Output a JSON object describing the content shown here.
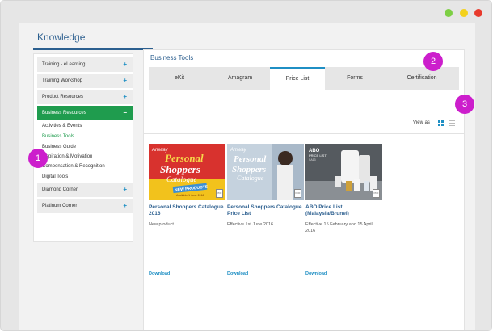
{
  "window": {
    "buttons": [
      "maximize",
      "minimize",
      "close"
    ]
  },
  "page": {
    "title": "Knowledge"
  },
  "sidebar": {
    "items": [
      {
        "label": "Training - eLearning",
        "toggle": "+"
      },
      {
        "label": "Training Workshop",
        "toggle": "+"
      },
      {
        "label": "Product Resources",
        "toggle": "+"
      },
      {
        "label": "Business Resources",
        "toggle": "−"
      },
      {
        "label": "Diamond Corner",
        "toggle": "+"
      },
      {
        "label": "Platinum Corner",
        "toggle": "+"
      }
    ],
    "sub_items": [
      "Activities & Events",
      "Business Tools",
      "Business Guide",
      "Inspiration & Motivation",
      "Compensation & Recognition",
      "Digital Tools"
    ]
  },
  "main": {
    "title": "Business Tools",
    "tabs": [
      "eKit",
      "Amagram",
      "Price List",
      "Forms",
      "Certification"
    ],
    "active_tab": "Price List",
    "view_as_label": "View as"
  },
  "products": [
    {
      "title": "Personal Shoppers Catalogue 2016",
      "desc": "New product",
      "download": "Download",
      "thumb": {
        "brand": "Amway",
        "line1": "Personal",
        "line2": "Shoppers",
        "line3": "Catalogue",
        "tag": "NEW PRODUCTS",
        "sub": "Available 1 June 2016"
      }
    },
    {
      "title": "Personal Shoppers Catalogue Price List",
      "desc": "Effective 1st June 2016",
      "download": "Download",
      "thumb": {
        "brand": "Amway",
        "line1": "Personal",
        "line2": "Shoppers",
        "line3": "Catalogue"
      }
    },
    {
      "title": "ABO Price List (Malaysia/Brunei)",
      "desc": "Effective 15 February and 15 April 2016",
      "download": "Download",
      "thumb": {
        "line1": "ABO",
        "line2": "PRICE LIST",
        "line3": "SA13"
      }
    }
  ],
  "file_icon_label": "PDF",
  "callouts": [
    "1",
    "2",
    "3"
  ],
  "colors": {
    "accent_blue": "#1f8fc4",
    "heading_blue": "#2c5f8f",
    "active_green": "#1f9c4e",
    "callout_magenta": "#cc1ecc"
  }
}
